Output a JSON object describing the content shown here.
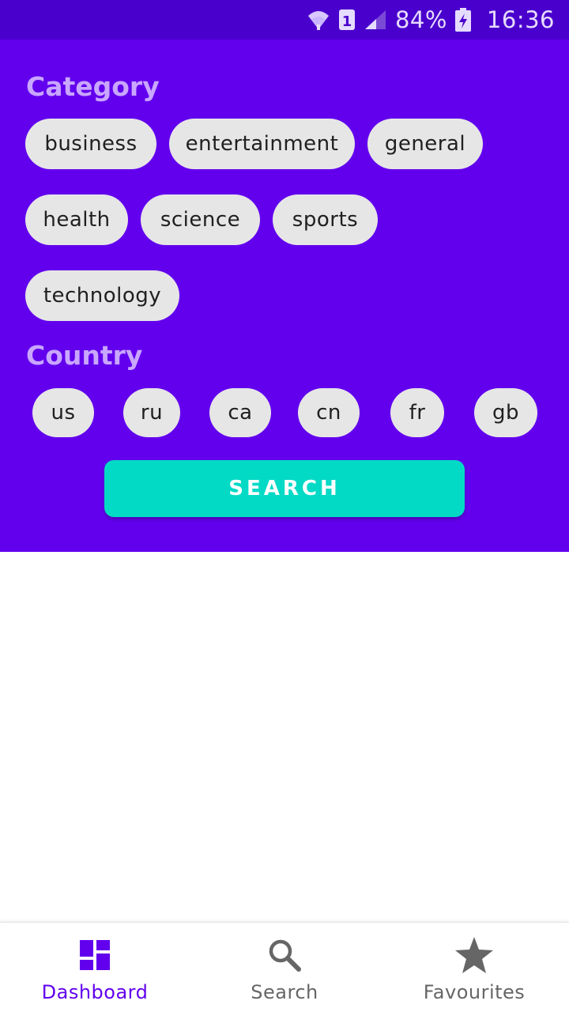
{
  "status_bar": {
    "sim_slot": "1",
    "battery_percent": "84%",
    "time": "16:36"
  },
  "filters": {
    "category_title": "Category",
    "categories": [
      "business",
      "entertainment",
      "general",
      "health",
      "science",
      "sports",
      "technology"
    ],
    "country_title": "Country",
    "countries": [
      "us",
      "ru",
      "ca",
      "cn",
      "fr",
      "gb"
    ],
    "search_button": "SEARCH"
  },
  "bottom_nav": {
    "items": [
      {
        "label": "Dashboard",
        "icon": "dashboard-icon",
        "selected": true
      },
      {
        "label": "Search",
        "icon": "search-icon",
        "selected": false
      },
      {
        "label": "Favourites",
        "icon": "star-icon",
        "selected": false
      }
    ]
  },
  "colors": {
    "primary": "#6200ee",
    "status_bar": "#4a00cc",
    "accent": "#03dac6",
    "chip_background": "#e6e6e6",
    "section_title": "#c9a6ff"
  }
}
